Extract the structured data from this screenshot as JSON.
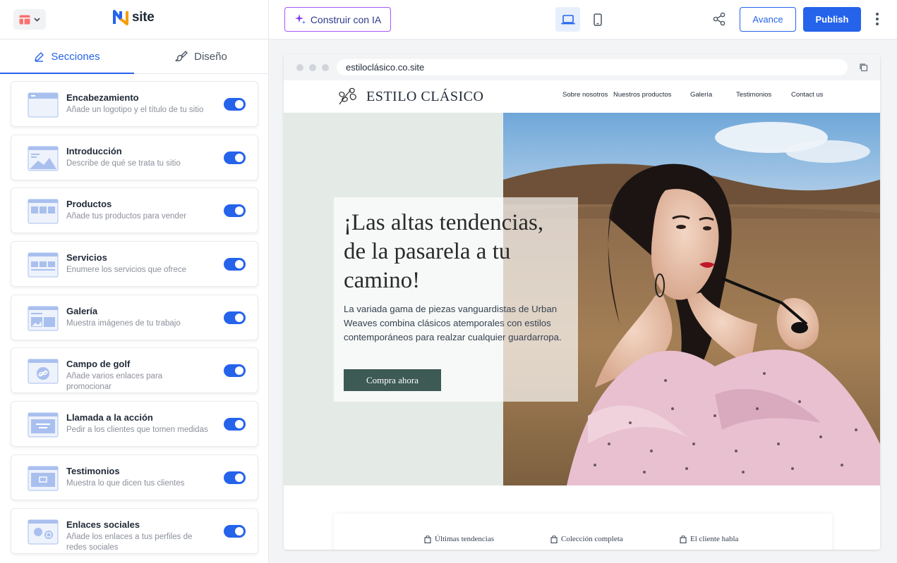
{
  "left_panel": {
    "logo_text": "site",
    "tabs": [
      {
        "label": "Secciones",
        "icon": "pencil-icon",
        "active": true
      },
      {
        "label": "Diseño",
        "icon": "paintbrush-icon",
        "active": false
      }
    ],
    "sections": [
      {
        "title": "Encabezamiento",
        "desc": "Añade un logotipo y el título de tu sitio",
        "thumb": "header-thumb-icon",
        "enabled": true
      },
      {
        "title": "Introducción",
        "desc": "Describe de qué se trata tu sitio",
        "thumb": "intro-thumb-icon",
        "enabled": true
      },
      {
        "title": "Productos",
        "desc": "Añade tus productos para vender",
        "thumb": "products-thumb-icon",
        "enabled": true
      },
      {
        "title": "Servicios",
        "desc": "Enumere los servicios que ofrece",
        "thumb": "services-thumb-icon",
        "enabled": true
      },
      {
        "title": "Galería",
        "desc": "Muestra imágenes de tu trabajo",
        "thumb": "gallery-thumb-icon",
        "enabled": true
      },
      {
        "title": "Campo de golf",
        "desc": "Añade varios enlaces para promocionar",
        "thumb": "link-thumb-icon",
        "enabled": true
      },
      {
        "title": "Llamada a la acción",
        "desc": "Pedir a los clientes que tomen medidas",
        "thumb": "cta-thumb-icon",
        "enabled": true
      },
      {
        "title": "Testimonios",
        "desc": "Muestra lo que dicen tus clientes",
        "thumb": "testimonials-thumb-icon",
        "enabled": true
      },
      {
        "title": "Enlaces sociales",
        "desc": "Añade los enlaces a tus perfiles de redes sociales",
        "thumb": "social-thumb-icon",
        "enabled": true
      }
    ]
  },
  "topbar": {
    "ai_label": "Construir con IA",
    "preview_label": "Avance",
    "publish_label": "Publish",
    "device_selected": "desktop"
  },
  "browser": {
    "url": "estiloclásico.co.site"
  },
  "site": {
    "brand": "ESTILO CLÁSICO",
    "nav": [
      "Sobre nosotros",
      "Nuestros productos",
      "Galería",
      "Testimonios",
      "Contact us"
    ],
    "hero_title": "¡Las altas tendencias, de la pasarela a tu camino!",
    "hero_text": "La variada gama de piezas vanguardistas de Urban Weaves combina clásicos atemporales con estilos contemporáneos para realzar cualquier guardarropa.",
    "cta": "Compra ahora",
    "categories": [
      "Últimas tendencias",
      "Colección completa",
      "El cliente habla"
    ]
  },
  "colors": {
    "accent": "#2563eb",
    "ai_border": "#a855f7",
    "cta_bg": "#3d5a54",
    "hero_bg": "#e4ebe7"
  }
}
